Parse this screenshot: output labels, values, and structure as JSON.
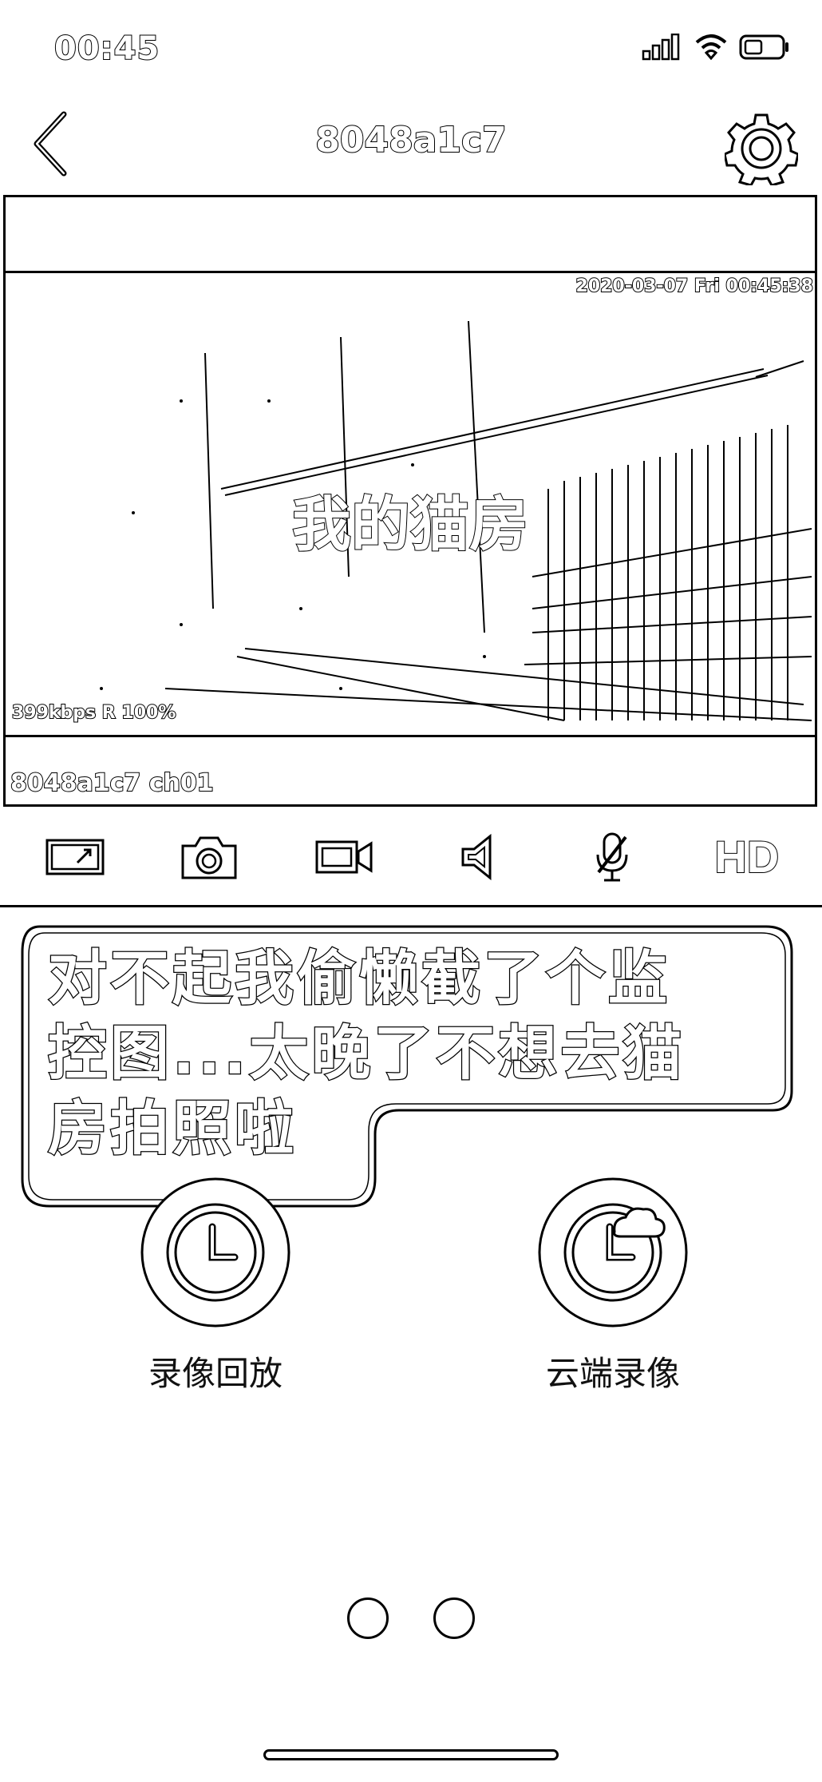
{
  "status_bar": {
    "time": "00:45",
    "icons": [
      "signal-icon",
      "wifi-icon",
      "battery-icon"
    ]
  },
  "nav": {
    "title": "8048a1c7",
    "back_icon": "chevron-left-icon",
    "settings_icon": "gear-icon"
  },
  "video": {
    "timestamp": "2020-03-07 Fri 00:45:38",
    "caption": "我的猫房",
    "bitrate": "399kbps R 100%",
    "channel": "8048a1c7 ch01"
  },
  "toolbar": {
    "items": [
      {
        "icon": "fullscreen-icon"
      },
      {
        "icon": "camera-icon"
      },
      {
        "icon": "record-video-icon"
      },
      {
        "icon": "speaker-icon"
      },
      {
        "icon": "microphone-muted-icon"
      },
      {
        "label": "HD"
      }
    ]
  },
  "bubble": {
    "lines": [
      "对不起我偷懒截了个监",
      "控图...太晚了不想去猫",
      "房拍照啦"
    ]
  },
  "features": [
    {
      "label": "录像回放",
      "icon": "clock-icon"
    },
    {
      "label": "云端录像",
      "icon": "cloud-clock-icon"
    }
  ]
}
